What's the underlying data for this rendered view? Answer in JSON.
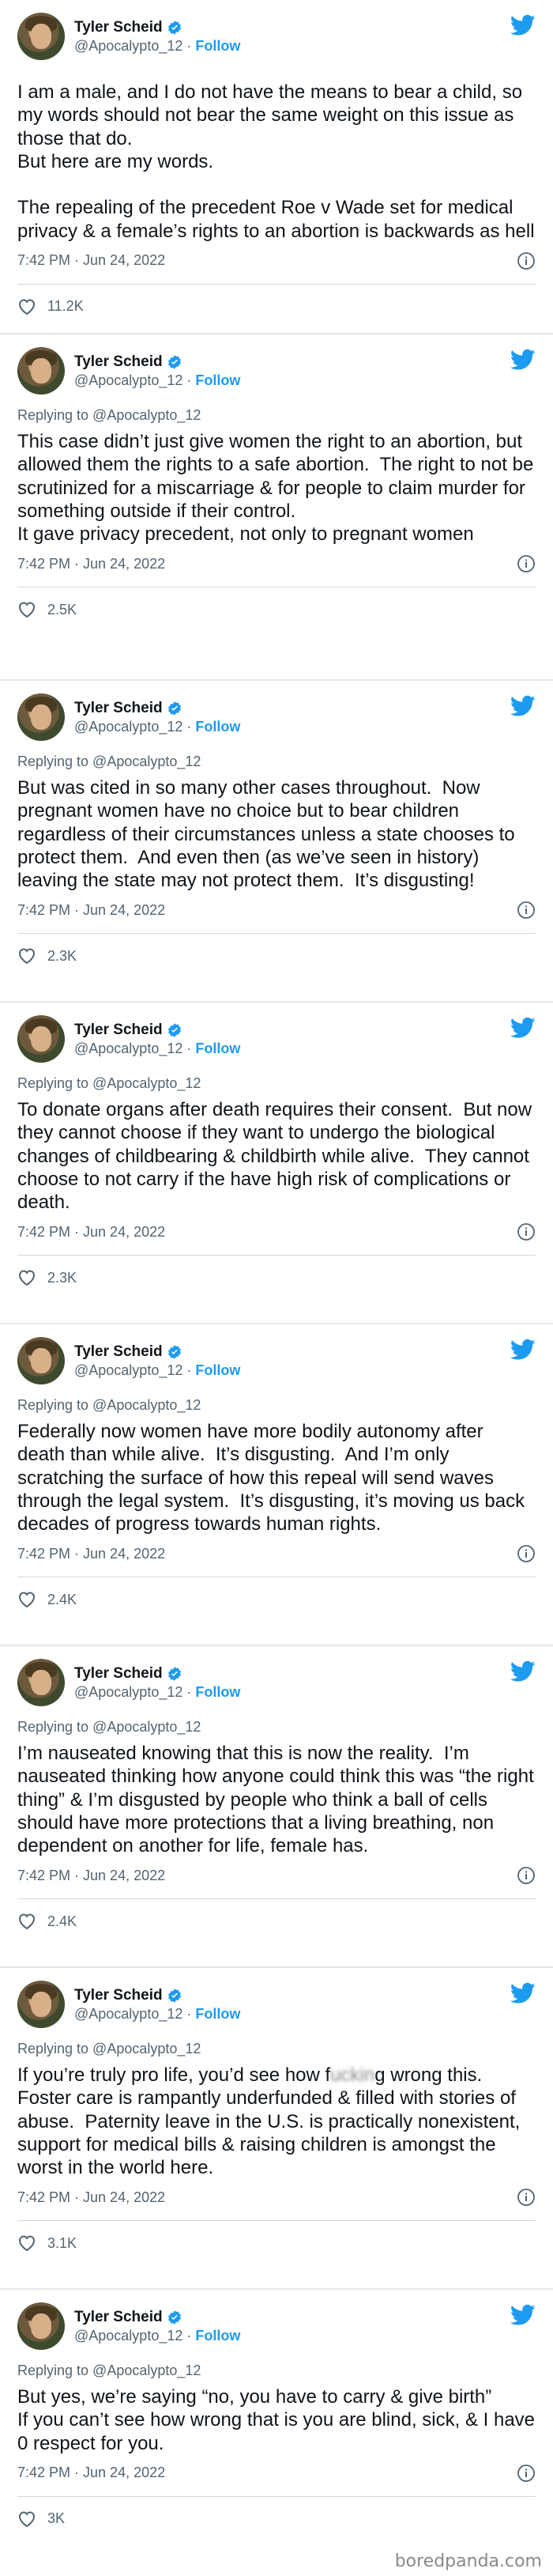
{
  "author": {
    "name": "Tyler Scheid",
    "handle": "@Apocalypto_12",
    "separator": "·",
    "follow_label": "Follow",
    "verified_icon": "verified-badge-icon",
    "accent_color": "#1d9bf0"
  },
  "watermark": "boredpanda.com",
  "tweets": [
    {
      "reply_to": "",
      "text": "I am a male, and I do not have the means to bear a child, so my words should not bear the same weight on this issue as those that do.\nBut here are my words.\n\nThe repealing of the precedent Roe v Wade set for medical privacy & a female’s rights to an abortion is backwards as hell",
      "time": "7:42 PM · Jun 24, 2022",
      "likes": "11.2K"
    },
    {
      "reply_to": "Replying to @Apocalypto_12",
      "text": "This case didn’t just give women the right to an abortion, but allowed them the rights to a safe abortion.  The right to not be scrutinized for a miscarriage & for people to claim murder for something outside if their control.\nIt gave privacy precedent, not only to pregnant women",
      "time": "7:42 PM · Jun 24, 2022",
      "likes": "2.5K"
    },
    {
      "reply_to": "Replying to @Apocalypto_12",
      "text": "But was cited in so many other cases throughout.  Now pregnant women have no choice but to bear children regardless of their circumstances unless a state chooses to protect them.  And even then (as we’ve seen in history) leaving the state may not protect them.  It’s disgusting!",
      "time": "7:42 PM · Jun 24, 2022",
      "likes": "2.3K"
    },
    {
      "reply_to": "Replying to @Apocalypto_12",
      "text": "To donate organs after death requires their consent.  But now they cannot choose if they want to undergo the biological changes of childbearing & childbirth while alive.  They cannot choose to not carry if the have high risk of complications or death.",
      "time": "7:42 PM · Jun 24, 2022",
      "likes": "2.3K"
    },
    {
      "reply_to": "Replying to @Apocalypto_12",
      "text": "Federally now women have more bodily autonomy after death than while alive.  It’s disgusting.  And I’m only scratching the surface of how this repeal will send waves through the legal system.  It’s disgusting, it’s moving us back decades of progress towards human rights.",
      "time": "7:42 PM · Jun 24, 2022",
      "likes": "2.4K"
    },
    {
      "reply_to": "Replying to @Apocalypto_12",
      "text": "I’m nauseated knowing that this is now the reality.  I’m nauseated thinking how anyone could think this was “the right thing” & I’m disgusted by people who think a ball of cells should have more protections that a living breathing, non dependent on another for life, female has.",
      "time": "7:42 PM · Jun 24, 2022",
      "likes": "2.4K"
    },
    {
      "reply_to": "Replying to @Apocalypto_12",
      "text_before": "If you’re truly pro life, you’d see how f",
      "text_blurred": "uckin",
      "text_after": "g wrong this.  Foster care is rampantly underfunded & filled with stories of abuse.  Paternity leave in the U.S. is practically nonexistent, support for medical bills & raising children is amongst the worst in the world here.",
      "time": "7:42 PM · Jun 24, 2022",
      "likes": "3.1K"
    },
    {
      "reply_to": "Replying to @Apocalypto_12",
      "text": "But yes, we’re saying “no, you have to carry & give birth”\nIf you can’t see how wrong that is you are blind, sick, & I have 0 respect for you.",
      "time": "7:42 PM · Jun 24, 2022",
      "likes": "3K"
    }
  ]
}
